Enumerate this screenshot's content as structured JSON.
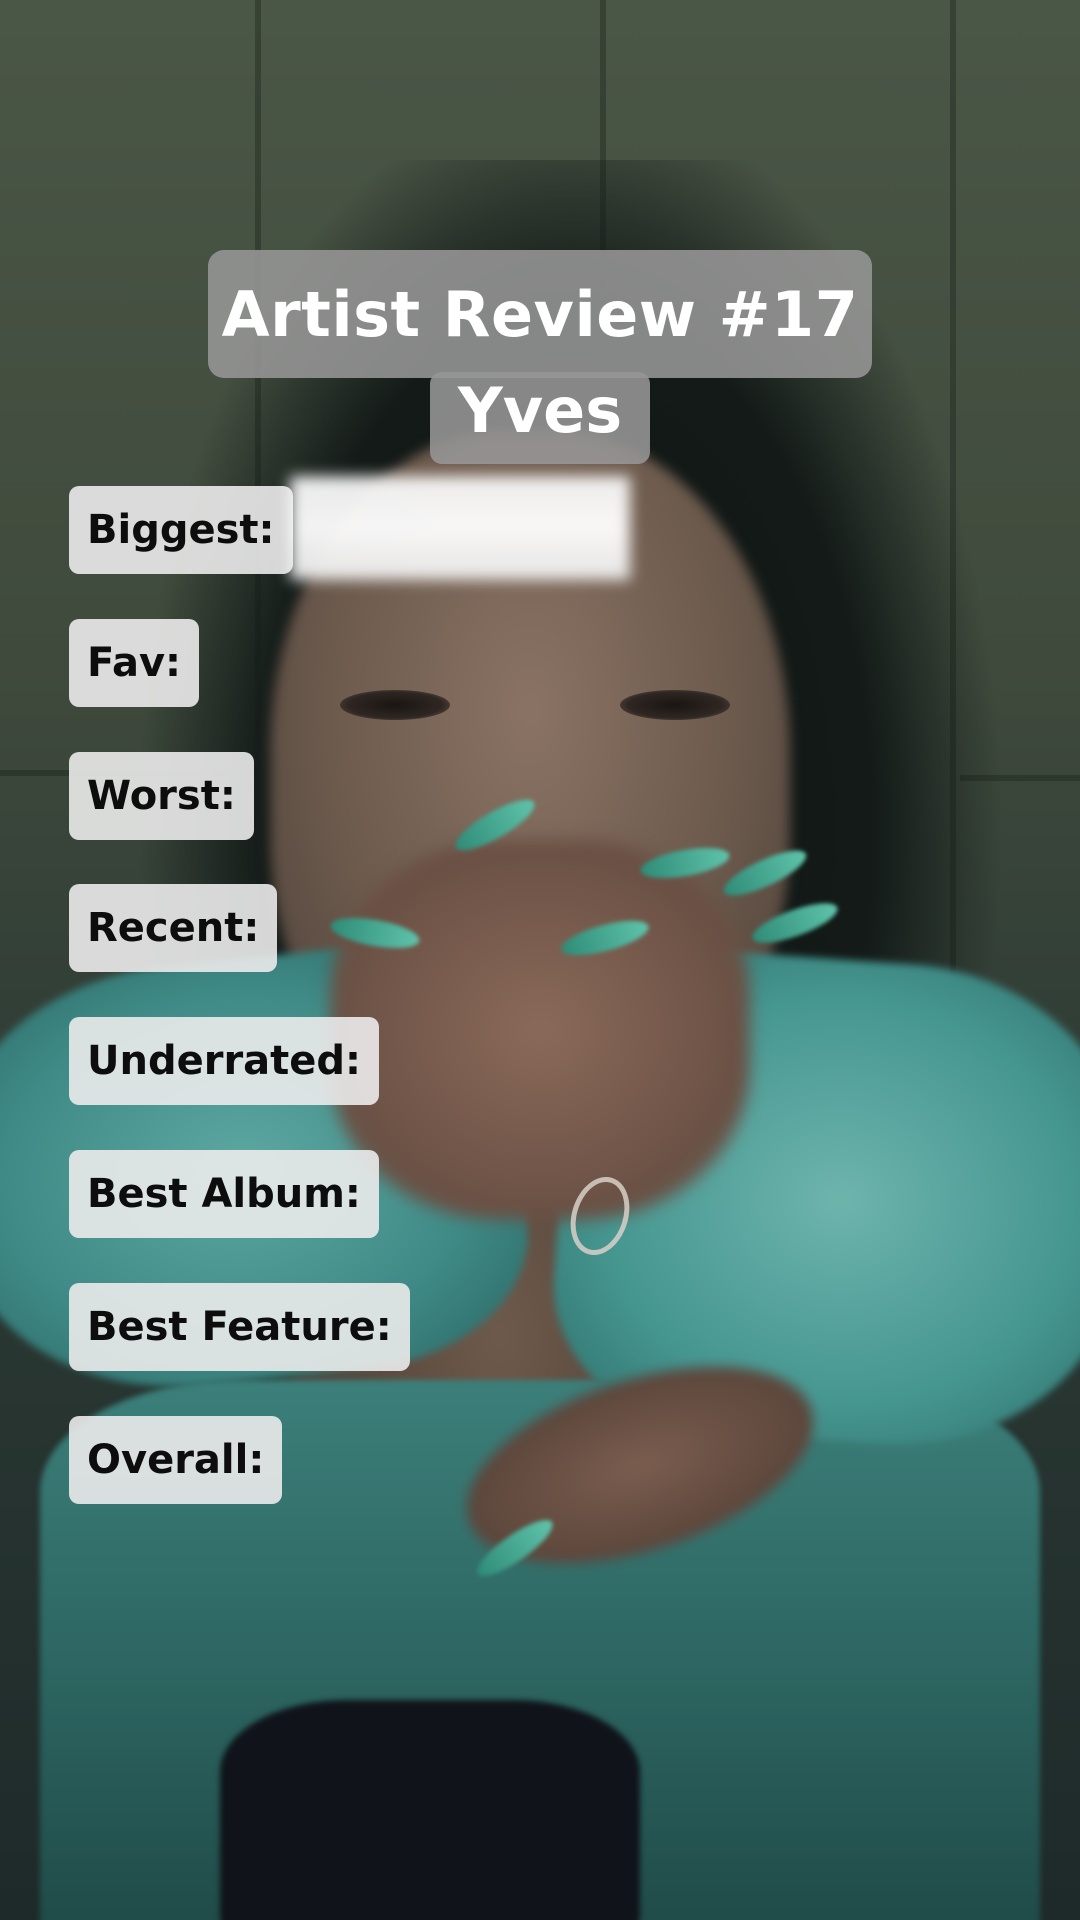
{
  "title": {
    "line1": "Artist Review #17",
    "line2": "Yves"
  },
  "labels": {
    "biggest": "Biggest:",
    "fav": "Fav:",
    "worst": "Worst:",
    "recent": "Recent:",
    "underrated": "Underrated:",
    "best_album": "Best Album:",
    "best_feature": "Best Feature:",
    "overall": "Overall:"
  },
  "colors": {
    "title_box": "#969696",
    "label_box": "#ebebeb",
    "title_text": "#ffffff",
    "label_text": "#0d0d0d"
  }
}
